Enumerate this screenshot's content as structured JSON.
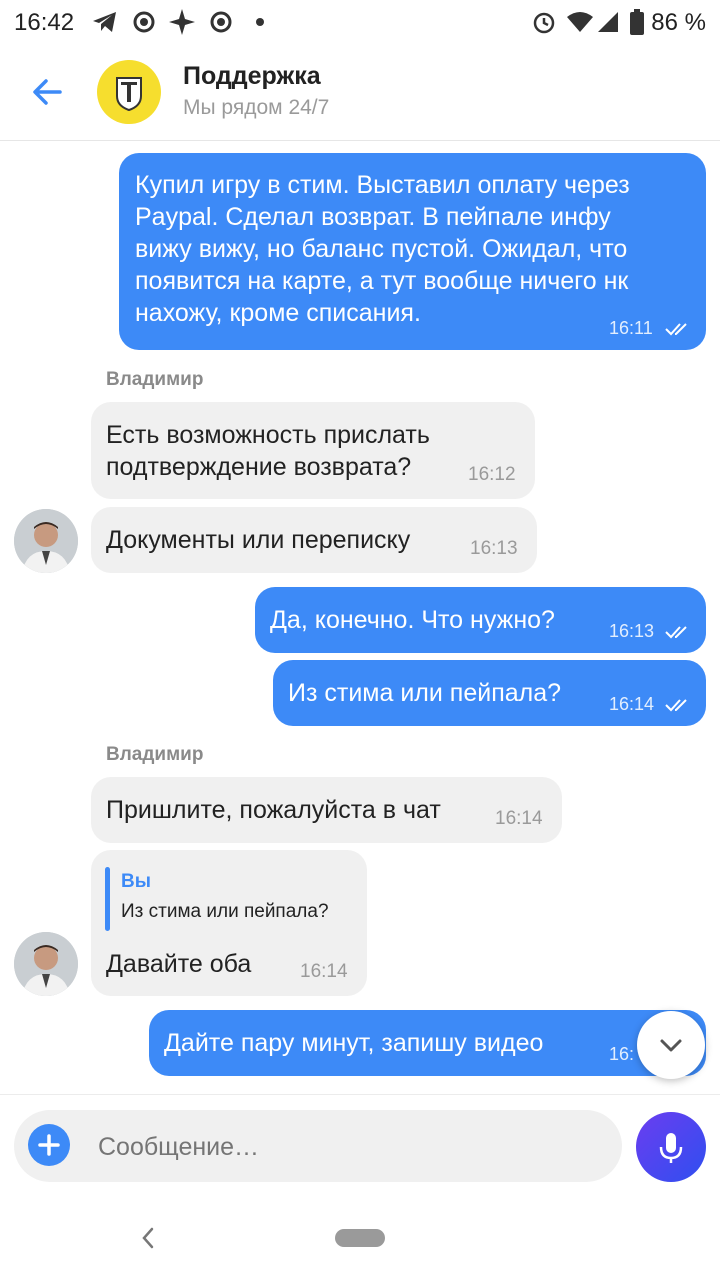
{
  "status_bar": {
    "time": "16:42",
    "battery": "86 %"
  },
  "header": {
    "title": "Поддержка",
    "subtitle": "Мы рядом 24/7"
  },
  "messages": {
    "m1": {
      "lines": [
        "Купил игру в стим. Выставил оплату через",
        "Paypal. Сделал возврат. В пейпале инфу",
        "вижу вижу, но баланс пустой. Ожидал, что",
        "появится на карте, а тут вообще ничего нк",
        "нахожу, кроме списания."
      ],
      "time": "16:11"
    },
    "sender1": "Владимир",
    "m2": {
      "lines": [
        "Есть возможность прислать",
        "подтверждение возврата?"
      ],
      "time": "16:12"
    },
    "m3": {
      "text": "Документы или переписку",
      "time": "16:13"
    },
    "m4": {
      "text": "Да, конечно. Что нужно?",
      "time": "16:13"
    },
    "m5": {
      "text": "Из стима или пейпала?",
      "time": "16:14"
    },
    "sender2": "Владимир",
    "m6": {
      "text": "Пришлите, пожалуйста в чат",
      "time": "16:14"
    },
    "m7": {
      "reply_author": "Вы",
      "reply_text": "Из стима или пейпала?",
      "text": "Давайте оба",
      "time": "16:14"
    },
    "m8": {
      "text": "Дайте пару минут, запишу видео",
      "time": "16:"
    }
  },
  "input": {
    "placeholder": "Сообщение…"
  },
  "colors": {
    "accent": "#3d8af7",
    "logo": "#f6de2e"
  }
}
